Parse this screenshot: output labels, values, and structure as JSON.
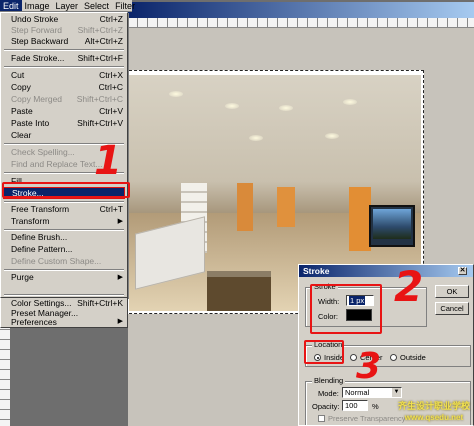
{
  "menubar": {
    "items": [
      {
        "label": "Edit",
        "active": true
      },
      {
        "label": "Image",
        "active": false
      },
      {
        "label": "Layer",
        "active": false
      },
      {
        "label": "Select",
        "active": false
      },
      {
        "label": "Filter",
        "active": false
      }
    ]
  },
  "edit_menu": {
    "items": [
      {
        "label": "Undo Stroke",
        "shortcut": "Ctrl+Z",
        "disabled": false
      },
      {
        "label": "Step Forward",
        "shortcut": "Shift+Ctrl+Z",
        "disabled": true
      },
      {
        "label": "Step Backward",
        "shortcut": "Alt+Ctrl+Z",
        "disabled": false
      },
      {
        "label": "Fade Stroke...",
        "shortcut": "Shift+Ctrl+F",
        "disabled": false
      },
      {
        "label": "Cut",
        "shortcut": "Ctrl+X",
        "disabled": false
      },
      {
        "label": "Copy",
        "shortcut": "Ctrl+C",
        "disabled": false
      },
      {
        "label": "Copy Merged",
        "shortcut": "Shift+Ctrl+C",
        "disabled": true
      },
      {
        "label": "Paste",
        "shortcut": "Ctrl+V",
        "disabled": false
      },
      {
        "label": "Paste Into",
        "shortcut": "Shift+Ctrl+V",
        "disabled": false
      },
      {
        "label": "Clear",
        "shortcut": "",
        "disabled": false
      },
      {
        "label": "Check Spelling...",
        "shortcut": "",
        "disabled": true
      },
      {
        "label": "Find and Replace Text...",
        "shortcut": "",
        "disabled": true
      },
      {
        "label": "Fill...",
        "shortcut": "",
        "disabled": false
      },
      {
        "label": "Stroke...",
        "shortcut": "",
        "disabled": false
      },
      {
        "label": "Free Transform",
        "shortcut": "Ctrl+T",
        "disabled": false
      },
      {
        "label": "Transform",
        "shortcut": "",
        "disabled": false
      },
      {
        "label": "Define Brush...",
        "shortcut": "",
        "disabled": false
      },
      {
        "label": "Define Pattern...",
        "shortcut": "",
        "disabled": false
      },
      {
        "label": "Define Custom Shape...",
        "shortcut": "",
        "disabled": true
      },
      {
        "label": "Purge",
        "shortcut": "",
        "disabled": false
      },
      {
        "label": "Color Settings...",
        "shortcut": "Shift+Ctrl+K",
        "disabled": false
      },
      {
        "label": "Preset Manager...",
        "shortcut": "",
        "disabled": false
      },
      {
        "label": "Preferences",
        "shortcut": "",
        "disabled": false
      }
    ]
  },
  "stroke_dialog": {
    "title": "Stroke",
    "stroke_group": "Stroke",
    "width_label": "Width:",
    "width_value": "1 px",
    "color_label": "Color:",
    "color_value": "#000000",
    "location_group": "Location",
    "location_options": [
      "Inside",
      "Center",
      "Outside"
    ],
    "location_selected": "Inside",
    "blending_group": "Blending",
    "mode_label": "Mode:",
    "mode_value": "Normal",
    "opacity_label": "Opacity:",
    "opacity_value": "100",
    "opacity_unit": "%",
    "preserve_label": "Preserve Transparency",
    "ok_label": "OK",
    "cancel_label": "Cancel"
  },
  "annotations": {
    "num1": "1",
    "num2": "2",
    "num3": "3",
    "color": "#e81414"
  },
  "watermark": {
    "line1": "齐生设计职业学校",
    "line2": "www.qsedu.net"
  }
}
